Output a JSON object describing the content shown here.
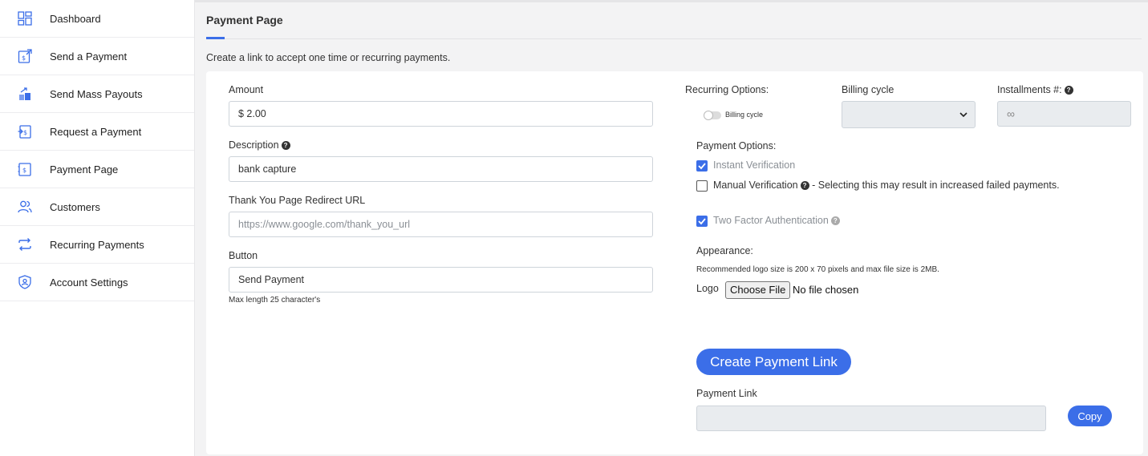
{
  "sidebar": {
    "items": [
      {
        "label": "Dashboard",
        "icon": "dashboard-icon"
      },
      {
        "label": "Send a Payment",
        "icon": "send-payment-icon"
      },
      {
        "label": "Send Mass Payouts",
        "icon": "mass-payouts-icon"
      },
      {
        "label": "Request a Payment",
        "icon": "request-payment-icon"
      },
      {
        "label": "Payment Page",
        "icon": "payment-page-icon"
      },
      {
        "label": "Customers",
        "icon": "customers-icon"
      },
      {
        "label": "Recurring Payments",
        "icon": "recurring-icon"
      },
      {
        "label": "Account Settings",
        "icon": "shield-user-icon"
      }
    ]
  },
  "header": {
    "title": "Payment Page",
    "subtitle": "Create a link to accept one time or recurring payments."
  },
  "form": {
    "amount_label": "Amount",
    "amount_value": "$ 2.00",
    "description_label": "Description",
    "description_value": "bank capture",
    "redirect_label": "Thank You Page Redirect URL",
    "redirect_placeholder": "https://www.google.com/thank_you_url",
    "button_label": "Button",
    "button_value": "Send Payment",
    "button_hint": "Max length 25 character's"
  },
  "options": {
    "recurring_label": "Recurring Options:",
    "toggle_label": "Billing cycle",
    "toggle_on": false,
    "billing_cycle_label": "Billing cycle",
    "billing_cycle_value": "",
    "installments_label": "Installments #:",
    "installments_value": "∞",
    "payment_options_label": "Payment Options:",
    "instant_verification": "Instant Verification",
    "instant_checked": true,
    "manual_verification": "Manual Verification",
    "manual_note": " - Selecting this may result in increased failed payments.",
    "manual_checked": false,
    "two_factor": "Two Factor Authentication",
    "two_factor_checked": true,
    "help_glyph": "?"
  },
  "appearance": {
    "label": "Appearance:",
    "logo_hint": "Recommended logo size is 200 x 70 pixels and max file size is 2MB.",
    "logo_label": "Logo",
    "choose_file": "Choose File",
    "no_file": "No file chosen"
  },
  "actions": {
    "create_link": "Create Payment Link",
    "payment_link_label": "Payment Link",
    "payment_link_value": "",
    "copy": "Copy"
  },
  "colors": {
    "accent": "#3b6ee8",
    "disabled_field": "#e9ecef"
  }
}
